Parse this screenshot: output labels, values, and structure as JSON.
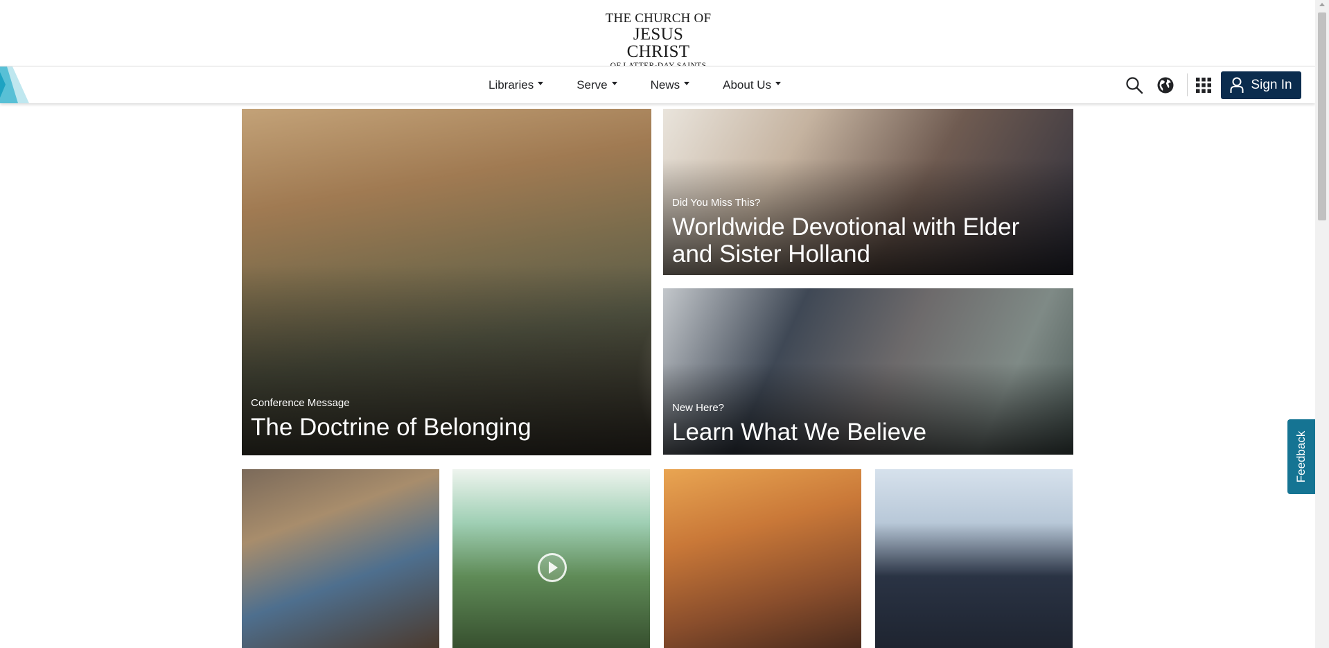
{
  "logo": {
    "line1": "THE CHURCH OF",
    "line2": "JESUS CHRIST",
    "line3": "OF LATTER-DAY SAINTS"
  },
  "nav": {
    "items": [
      {
        "label": "Libraries"
      },
      {
        "label": "Serve"
      },
      {
        "label": "News"
      },
      {
        "label": "About Us"
      }
    ],
    "sign_in_label": "Sign In",
    "icons": [
      "search-icon",
      "globe-icon",
      "apps-grid-icon",
      "user-icon"
    ]
  },
  "hero": {
    "main": {
      "kicker": "Conference Message",
      "title": "The Doctrine of Belonging"
    },
    "top_right": {
      "kicker": "Did You Miss This?",
      "title": "Worldwide Devotional with Elder and Sister Holland"
    },
    "bottom_right": {
      "kicker": "New Here?",
      "title": "Learn What We Believe"
    }
  },
  "tiles": [
    {
      "image": "father-and-daughter-reading"
    },
    {
      "image": "forest-walk-video",
      "icon": "play-icon"
    },
    {
      "image": "christ-teaching-painting"
    },
    {
      "image": "group-of-youth-outdoors"
    }
  ],
  "feedback_label": "Feedback",
  "colors": {
    "signin_bg": "#0b2c4e",
    "feedback_bg": "#157493",
    "text": "#212225"
  }
}
